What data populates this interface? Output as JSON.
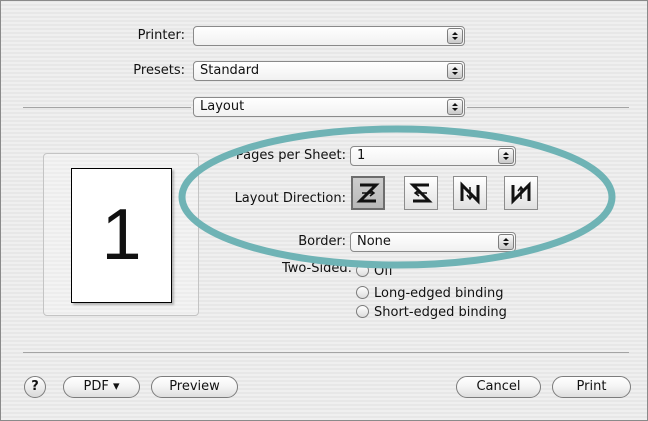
{
  "printer": {
    "label": "Printer:",
    "value": ""
  },
  "presets": {
    "label": "Presets:",
    "value": "Standard"
  },
  "panel": {
    "value": "Layout"
  },
  "preview": {
    "page_number": "1"
  },
  "layout": {
    "pages_per_sheet": {
      "label": "Pages per Sheet:",
      "value": "1"
    },
    "direction": {
      "label": "Layout Direction:",
      "options": [
        "z-left-right-top-bottom",
        "z-right-left-top-bottom",
        "n-top-bottom-left-right",
        "n-top-bottom-right-left"
      ],
      "selected": 0
    },
    "border": {
      "label": "Border:",
      "value": "None"
    },
    "two_sided": {
      "label": "Two-Sided:",
      "options": [
        "Off",
        "Long-edged binding",
        "Short-edged binding"
      ]
    }
  },
  "footer": {
    "help_label": "?",
    "pdf_label": "PDF ▾",
    "preview_label": "Preview",
    "cancel_label": "Cancel",
    "print_label": "Print"
  },
  "colors": {
    "highlight_ellipse": "#6fb3b5",
    "window_bg": "#ececec"
  }
}
